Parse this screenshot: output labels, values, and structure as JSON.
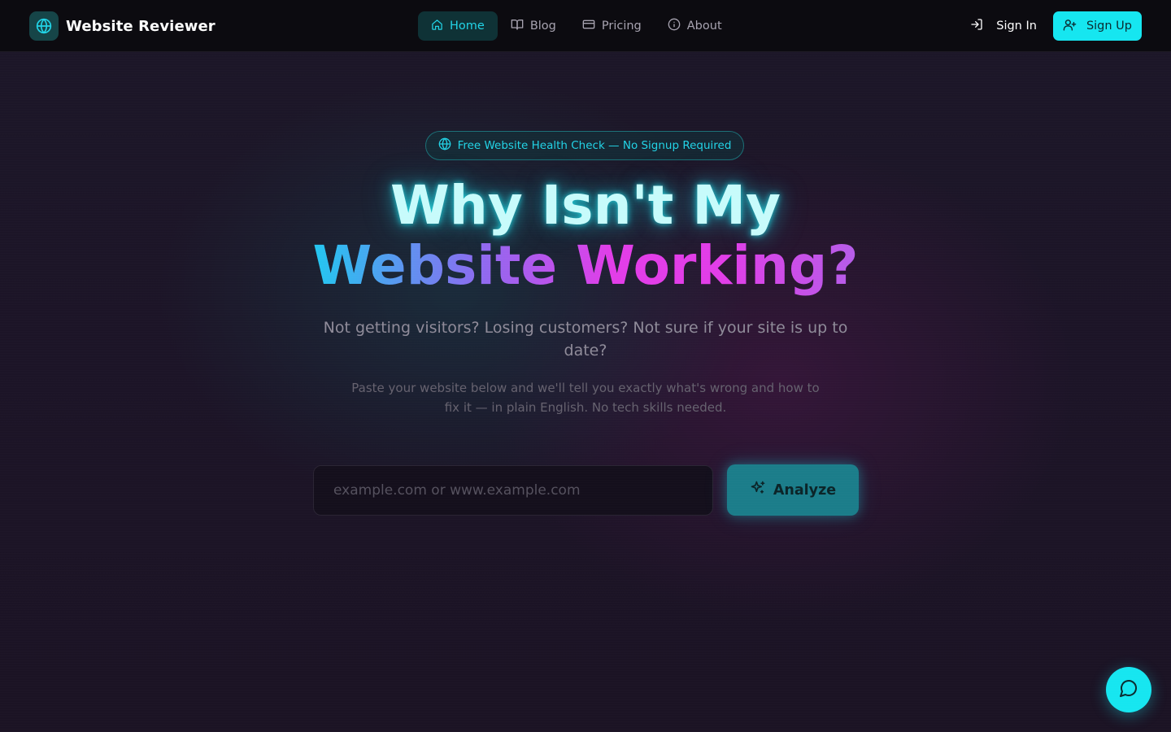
{
  "brand": {
    "name": "Website Reviewer",
    "logo_icon": "globe-icon"
  },
  "nav": {
    "items": [
      {
        "label": "Home",
        "icon": "home-icon",
        "active": true
      },
      {
        "label": "Blog",
        "icon": "book-icon",
        "active": false
      },
      {
        "label": "Pricing",
        "icon": "credit-card-icon",
        "active": false
      },
      {
        "label": "About",
        "icon": "info-icon",
        "active": false
      }
    ]
  },
  "auth": {
    "signin_label": "Sign In",
    "signin_icon": "login-icon",
    "signup_label": "Sign Up",
    "signup_icon": "user-plus-icon"
  },
  "hero": {
    "badge": "Free Website Health Check — No Signup Required",
    "badge_icon": "globe-icon",
    "headline_line1": "Why Isn't My",
    "headline_line2": "Website Working?",
    "subtitle": "Not getting visitors? Losing customers? Not sure if your site is up to date?",
    "description": "Paste your website below and we'll tell you exactly what's wrong and how to fix it — in plain English. No tech skills needed."
  },
  "search": {
    "placeholder": "example.com or www.example.com",
    "value": "",
    "button_label": "Analyze",
    "button_icon": "sparkles-icon"
  },
  "chat": {
    "icon": "chat-bubble-icon"
  },
  "colors": {
    "accent": "#16e6f0",
    "background": "#1a1226",
    "navbar": "#0c0b10",
    "magenta": "#e23de8"
  }
}
